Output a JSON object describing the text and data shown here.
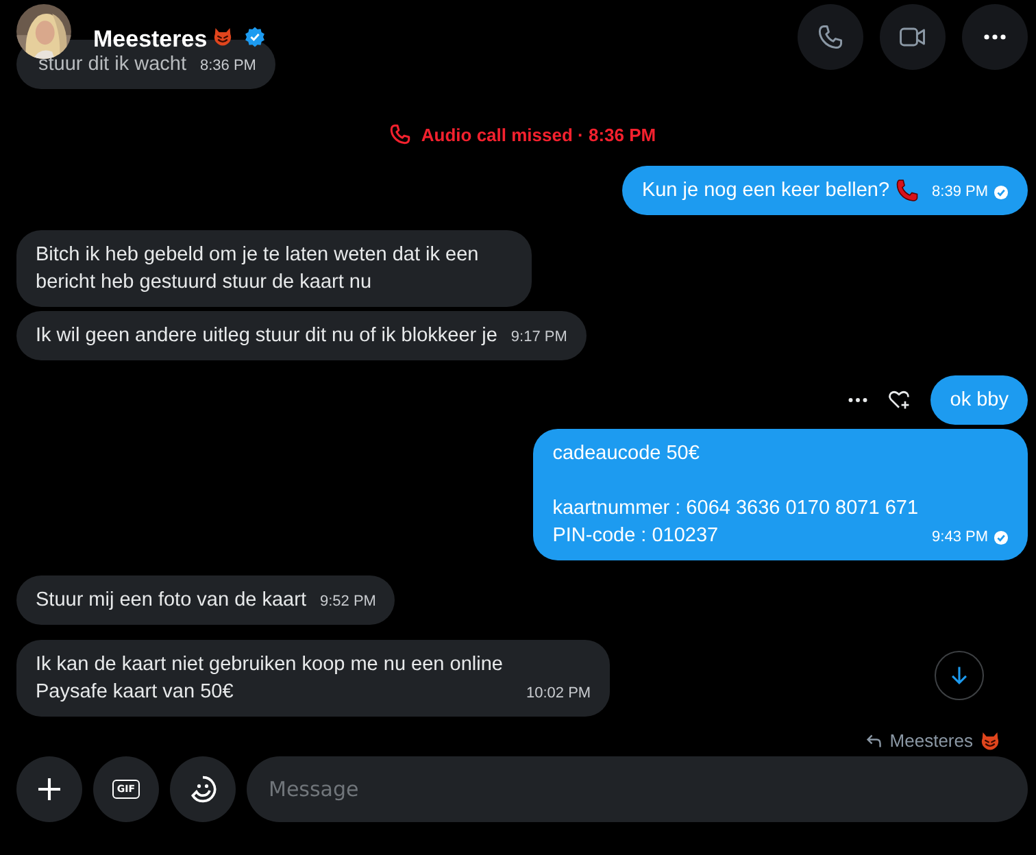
{
  "header": {
    "name": "Meesteres",
    "verified": true
  },
  "messages": [
    {
      "kind": "received",
      "text": "stuur dit ik wacht",
      "time": "8:36 PM"
    },
    {
      "kind": "event",
      "text": "Audio call missed · 8:36 PM"
    },
    {
      "kind": "sent",
      "text": "Kun je nog een keer bellen?",
      "has_phone_emoji": true,
      "time": "8:39 PM",
      "read": true
    },
    {
      "kind": "received",
      "text": "Bitch ik heb gebeld om je te laten weten dat ik een bericht heb gestuurd stuur de kaart nu"
    },
    {
      "kind": "received",
      "text": "Ik wil geen andere uitleg stuur dit nu of ik blokkeer je",
      "time": "9:17 PM"
    },
    {
      "kind": "sent",
      "text": "ok bby",
      "hovered": true
    },
    {
      "kind": "sent",
      "text": "cadeaucode 50€\n\nkaartnummer : 6064 3636 0170 8071 671\nPIN-code : 010237",
      "time": "9:43 PM",
      "read": true
    },
    {
      "kind": "received",
      "text": "Stuur mij een foto van de kaart",
      "time": "9:52 PM"
    },
    {
      "kind": "received",
      "text": "Ik kan de kaart niet gebruiken koop me nu een online Paysafe kaart van 50€",
      "time": "10:02 PM"
    }
  ],
  "reply_to": {
    "name": "Meesteres"
  },
  "composer": {
    "placeholder": "Message",
    "gif_label": "GIF"
  }
}
